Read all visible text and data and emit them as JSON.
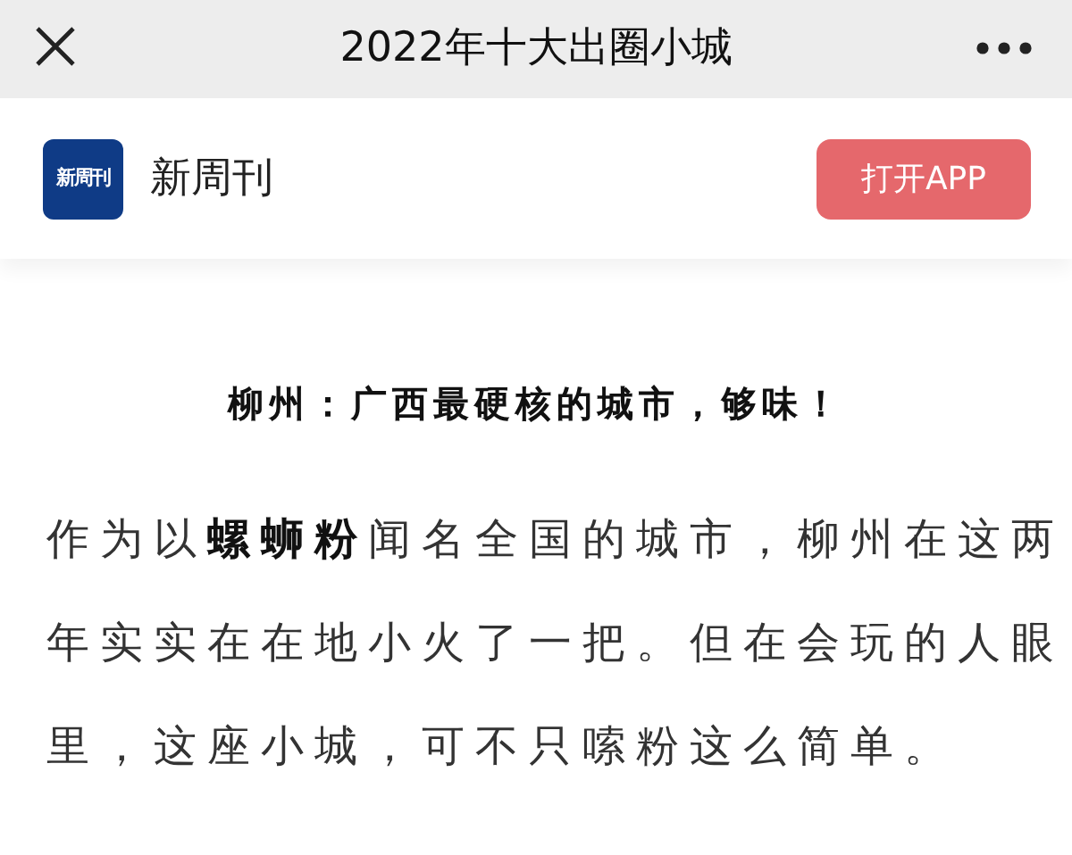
{
  "top_bar": {
    "title": "2022年十大出圈小城"
  },
  "account": {
    "logo_text": "新周刊",
    "name": "新周刊",
    "button": "打开APP"
  },
  "article": {
    "heading": "柳州：广西最硬核的城市，够味！",
    "paragraph": "作为以**螺蛳粉**闻名全国的城市，柳州在这两年实实在在地小火了一把。但在会玩的人眼里，这座小城，可不只嗦粉这么简单。"
  }
}
